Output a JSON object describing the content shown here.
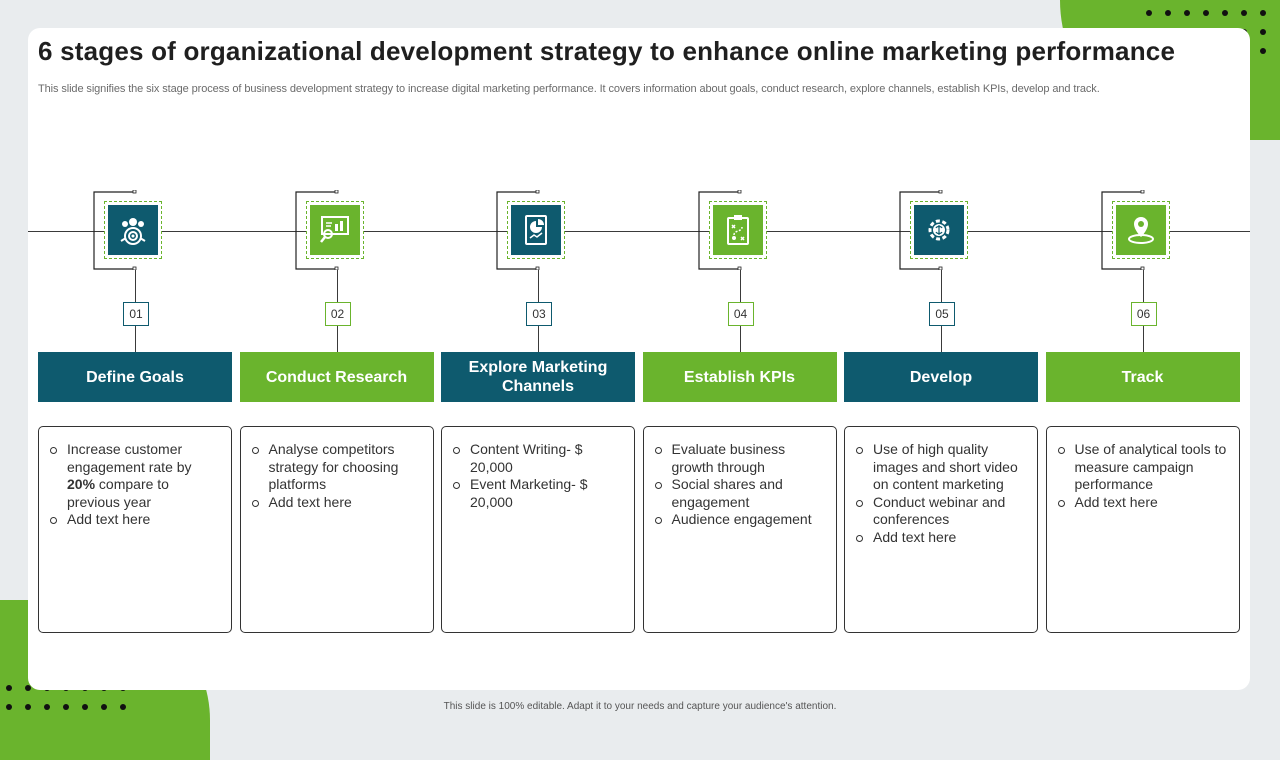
{
  "slide": {
    "title": "6 stages of organizational development strategy to enhance online marketing performance",
    "subtitle": "This slide signifies the six stage process of business development strategy to increase digital marketing performance. It covers information about goals, conduct research, explore channels, establish KPIs, develop and track.",
    "footer": "This slide is 100% editable. Adapt it to your needs and capture your audience's attention."
  },
  "colors": {
    "teal": "#0e5a6e",
    "green": "#6ab42d",
    "dark_line": "#3a3a3a"
  },
  "stages": [
    {
      "number": "01",
      "title": "Define Goals",
      "color": "teal",
      "icon": "team-target-icon",
      "bullets": [
        {
          "pre": "Increase customer engagement rate by ",
          "bold": "20%",
          "post": " compare to previous year"
        },
        {
          "pre": "Add text here",
          "bold": "",
          "post": ""
        }
      ]
    },
    {
      "number": "02",
      "title": "Conduct Research",
      "color": "green",
      "icon": "presentation-research-icon",
      "bullets": [
        {
          "pre": "Analyse competitors strategy for choosing platforms",
          "bold": "",
          "post": ""
        },
        {
          "pre": "Add text here",
          "bold": "",
          "post": ""
        }
      ]
    },
    {
      "number": "03",
      "title": "Explore Marketing Channels",
      "color": "teal",
      "icon": "report-chart-icon",
      "bullets": [
        {
          "pre": "Content Writing- $ 20,000",
          "bold": "",
          "post": ""
        },
        {
          "pre": "Event Marketing- $ 20,000",
          "bold": "",
          "post": ""
        }
      ]
    },
    {
      "number": "04",
      "title": "Establish KPIs",
      "color": "green",
      "icon": "clipboard-strategy-icon",
      "bullets": [
        {
          "pre": "Evaluate business growth through",
          "bold": "",
          "post": ""
        },
        {
          "pre": "Social shares and engagement",
          "bold": "",
          "post": ""
        },
        {
          "pre": "Audience engagement",
          "bold": "",
          "post": ""
        }
      ]
    },
    {
      "number": "05",
      "title": "Develop",
      "color": "teal",
      "icon": "gear-brain-icon",
      "bullets": [
        {
          "pre": "Use of high quality images and short video on content marketing",
          "bold": "",
          "post": ""
        },
        {
          "pre": "Conduct webinar and conferences",
          "bold": "",
          "post": ""
        },
        {
          "pre": "Add text here",
          "bold": "",
          "post": ""
        }
      ]
    },
    {
      "number": "06",
      "title": "Track",
      "color": "green",
      "icon": "location-pin-icon",
      "bullets": [
        {
          "pre": "Use of analytical tools to measure campaign performance",
          "bold": "",
          "post": ""
        },
        {
          "pre": "Add text here",
          "bold": "",
          "post": ""
        }
      ]
    }
  ]
}
